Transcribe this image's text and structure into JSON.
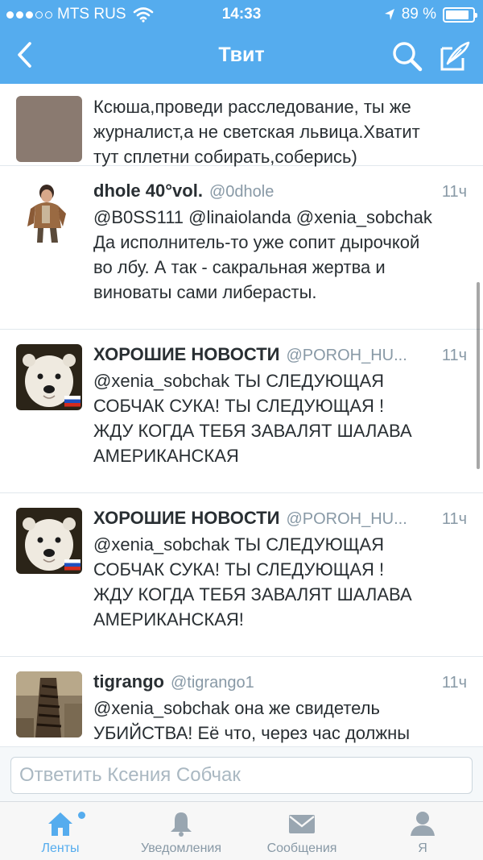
{
  "status_bar": {
    "carrier": "MTS RUS",
    "time": "14:33",
    "battery_text": "89 %",
    "battery_level": 0.89,
    "signal_bars_filled": 3,
    "icons": [
      "wifi-icon",
      "location-arrow-icon",
      "battery-icon"
    ]
  },
  "nav": {
    "title": "Твит",
    "icons": [
      "back-chevron-icon",
      "search-icon",
      "compose-icon"
    ]
  },
  "tweets": [
    {
      "name": "",
      "handle": "",
      "time": "",
      "text": "Ксюша,проведи расследование, ты же\nжурналист,а не светская львица.Хватит\nтут сплетни собирать,соберись)"
    },
    {
      "name": "dhole 40°vol.",
      "handle": "@0dhole",
      "time": "11ч",
      "text": "@B0SS111 @linaiolanda @xenia_sobchak\nДа исполнитель-то уже сопит дырочкой\nво лбу. А так - сакральная жертва и\nвиноваты сами либерасты."
    },
    {
      "name": "ХОРОШИЕ НОВОСТИ",
      "handle": "@POROH_HU...",
      "time": "11ч",
      "text": "@xenia_sobchak ТЫ СЛЕДУЮЩАЯ\nСОБЧАК СУКА! ТЫ СЛЕДУЮЩАЯ !\nЖДУ КОГДА ТЕБЯ ЗАВАЛЯТ ШАЛАВА\nАМЕРИКАНСКАЯ"
    },
    {
      "name": "ХОРОШИЕ НОВОСТИ",
      "handle": "@POROH_HU...",
      "time": "11ч",
      "text": "@xenia_sobchak ТЫ СЛЕДУЮЩАЯ\nСОБЧАК СУКА! ТЫ СЛЕДУЮЩАЯ !\nЖДУ КОГДА ТЕБЯ ЗАВАЛЯТ ШАЛАВА\nАМЕРИКАНСКАЯ!"
    },
    {
      "name": "tigrango",
      "handle": "@tigrango1",
      "time": "11ч",
      "text": "@xenia_sobchak она же свидетель\nУБИЙСТВА! Её что, через час должны"
    }
  ],
  "reply": {
    "placeholder": "Ответить Ксения Собчак"
  },
  "tabs": [
    {
      "label": "Ленты",
      "icon": "home-icon",
      "active": true
    },
    {
      "label": "Уведомления",
      "icon": "bell-icon",
      "active": false
    },
    {
      "label": "Сообщения",
      "icon": "envelope-icon",
      "active": false
    },
    {
      "label": "Я",
      "icon": "person-icon",
      "active": false
    }
  ],
  "colors": {
    "brand": "#55acee",
    "text": "#292f33",
    "secondary": "#8899a6"
  }
}
